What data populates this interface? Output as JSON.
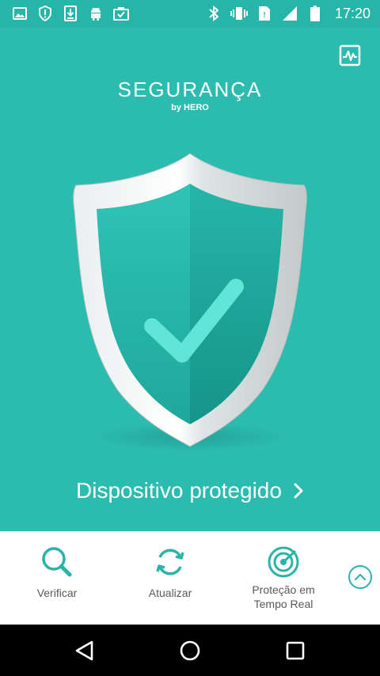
{
  "status_bar": {
    "time": "17:20",
    "left_icons": [
      "image-icon",
      "alert-shield-icon",
      "download-icon",
      "android-icon",
      "briefcase-icon"
    ],
    "right_icons": [
      "bluetooth-icon",
      "vibrate-icon",
      "no-sim-icon",
      "signal-icon",
      "battery-icon"
    ]
  },
  "header": {
    "title": "SEGURANÇA",
    "subtitle": "by HERO",
    "action_icon": "activity-chart-icon"
  },
  "status": {
    "label": "Dispositivo protegido",
    "icon": "shield-check-icon"
  },
  "actions": [
    {
      "label": "Verificar",
      "icon": "search-icon"
    },
    {
      "label": "Atualizar",
      "icon": "refresh-icon"
    },
    {
      "label_line1": "Proteção em",
      "label_line2": "Tempo Real",
      "icon": "radar-target-icon"
    }
  ],
  "expand_icon": "chevron-up-circle-icon",
  "nav": [
    "back-icon",
    "home-icon",
    "recents-icon"
  ],
  "colors": {
    "primary": "#2cbbaf",
    "status_bar": "#27b5a9",
    "accent": "#2ab3a8",
    "text_gray": "#595959"
  }
}
